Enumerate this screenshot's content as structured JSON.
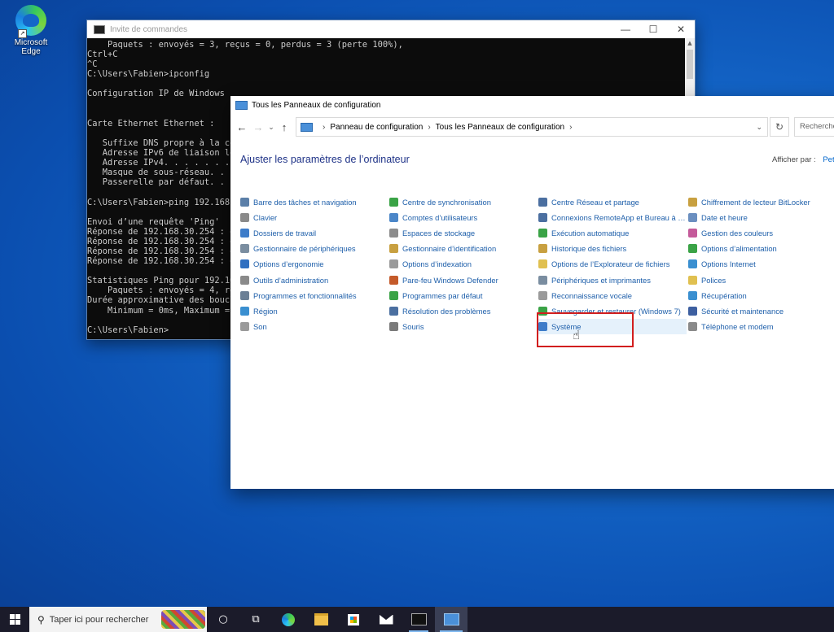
{
  "desktop": {
    "icons": [
      {
        "label": "Microsoft Edge",
        "icon": "edge-icon"
      }
    ]
  },
  "cmd_window": {
    "title": "Invite de commandes",
    "controls": [
      "—",
      "☐",
      "✕"
    ],
    "lines": [
      "    Paquets : envoyés = 3, reçus = 0, perdus = 3 (perte 100%),",
      "Ctrl+C",
      "^C",
      "C:\\Users\\Fabien>ipconfig",
      "",
      "Configuration IP de Windows",
      "",
      "",
      "Carte Ethernet Ethernet :",
      "",
      "   Suffixe DNS propre à la co",
      "   Adresse IPv6 de liaison lo",
      "   Adresse IPv4. . . . . . .",
      "   Masque de sous-réseau. . .",
      "   Passerelle par défaut. . .",
      "",
      "C:\\Users\\Fabien>ping 192.168.",
      "",
      "Envoi d’une requête 'Ping'  1",
      "Réponse de 192.168.30.254 : o",
      "Réponse de 192.168.30.254 : o",
      "Réponse de 192.168.30.254 : o",
      "Réponse de 192.168.30.254 : o",
      "",
      "Statistiques Ping pour 192.16",
      "    Paquets : envoyés = 4, re",
      "Durée approximative des boucl",
      "    Minimum = 0ms, Maximum =",
      "",
      "C:\\Users\\Fabien>"
    ]
  },
  "control_panel": {
    "title": "Tous les Panneaux de configuration",
    "breadcrumb": [
      "Panneau de configuration",
      "Tous les Panneaux de configuration"
    ],
    "search_placeholder": "Recherche",
    "heading": "Ajuster les paramètres de l’ordinateur",
    "view_by_label": "Afficher par :",
    "view_by_value": "Pet",
    "selected_item": "Système",
    "columns": [
      [
        {
          "label": "Barre des tâches et navigation",
          "color": "#5b7fa8"
        },
        {
          "label": "Clavier",
          "color": "#8a8a8a"
        },
        {
          "label": "Dossiers de travail",
          "color": "#3d7cc9"
        },
        {
          "label": "Gestionnaire de périphériques",
          "color": "#7a8da0"
        },
        {
          "label": "Options d’ergonomie",
          "color": "#2f6fc0"
        },
        {
          "label": "Outils d’administration",
          "color": "#8a8a8a"
        },
        {
          "label": "Programmes et fonctionnalités",
          "color": "#6b7f95"
        },
        {
          "label": "Région",
          "color": "#3a8fd0"
        },
        {
          "label": "Son",
          "color": "#9a9a9a"
        }
      ],
      [
        {
          "label": "Centre de synchronisation",
          "color": "#3aa346"
        },
        {
          "label": "Comptes d’utilisateurs",
          "color": "#4b86c8"
        },
        {
          "label": "Espaces de stockage",
          "color": "#8c8c8c"
        },
        {
          "label": "Gestionnaire d’identification",
          "color": "#c8a040"
        },
        {
          "label": "Options d’indexation",
          "color": "#9a9a9a"
        },
        {
          "label": "Pare-feu Windows Defender",
          "color": "#c45a2a"
        },
        {
          "label": "Programmes par défaut",
          "color": "#3aa346"
        },
        {
          "label": "Résolution des problèmes",
          "color": "#4b6fa0"
        },
        {
          "label": "Souris",
          "color": "#7a7a7a"
        }
      ],
      [
        {
          "label": "Centre Réseau et partage",
          "color": "#4b6fa0"
        },
        {
          "label": "Connexions RemoteApp et Bureau à …",
          "color": "#4b6fa0"
        },
        {
          "label": "Exécution automatique",
          "color": "#3aa346"
        },
        {
          "label": "Historique des fichiers",
          "color": "#c8a040"
        },
        {
          "label": "Options de l’Explorateur de fichiers",
          "color": "#e0c050"
        },
        {
          "label": "Périphériques et imprimantes",
          "color": "#7a8da0"
        },
        {
          "label": "Reconnaissance vocale",
          "color": "#9a9a9a"
        },
        {
          "label": "Sauvegarder et restaurer (Windows 7)",
          "color": "#3aa346"
        },
        {
          "label": "Système",
          "color": "#3d7cc9"
        }
      ],
      [
        {
          "label": "Chiffrement de lecteur BitLocker",
          "color": "#c8a040"
        },
        {
          "label": "Date et heure",
          "color": "#6b8fc0"
        },
        {
          "label": "Gestion des couleurs",
          "color": "#c45a9a"
        },
        {
          "label": "Options d’alimentation",
          "color": "#3aa346"
        },
        {
          "label": "Options Internet",
          "color": "#3a8fd0"
        },
        {
          "label": "Polices",
          "color": "#e0c050"
        },
        {
          "label": "Récupération",
          "color": "#3a8fd0"
        },
        {
          "label": "Sécurité et maintenance",
          "color": "#3d5fa0"
        },
        {
          "label": "Téléphone et modem",
          "color": "#8a8a8a"
        }
      ]
    ]
  },
  "taskbar": {
    "search_placeholder": "Taper ici pour rechercher",
    "apps": [
      "cortana-icon",
      "task-view-icon",
      "edge-icon",
      "file-explorer-icon",
      "store-icon",
      "mail-icon",
      "cmd-icon",
      "control-panel-icon"
    ]
  }
}
